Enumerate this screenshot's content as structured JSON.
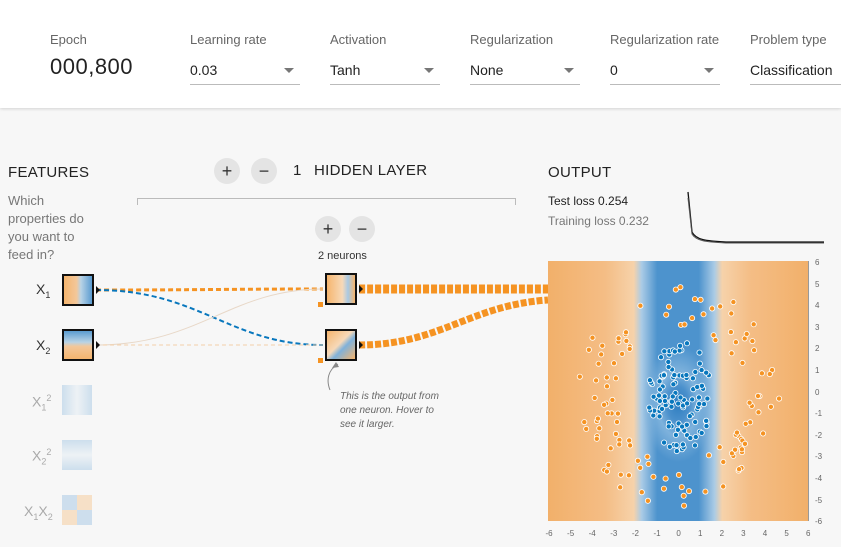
{
  "controls": {
    "epoch_label": "Epoch",
    "epoch_value": "000,800",
    "learning_rate_label": "Learning rate",
    "learning_rate_value": "0.03",
    "activation_label": "Activation",
    "activation_value": "Tanh",
    "regularization_label": "Regularization",
    "regularization_value": "None",
    "regularization_rate_label": "Regularization rate",
    "regularization_rate_value": "0",
    "problem_type_label": "Problem type",
    "problem_type_value": "Classification"
  },
  "features": {
    "title": "FEATURES",
    "question": "Which properties do you want to feed in?",
    "items": [
      {
        "base": "X",
        "sub": "1",
        "sup": "",
        "active": true
      },
      {
        "base": "X",
        "sub": "2",
        "sup": "",
        "active": true
      },
      {
        "base": "X",
        "sub": "1",
        "sup": "2",
        "active": false
      },
      {
        "base": "X",
        "sub": "2",
        "sup": "2",
        "active": false
      },
      {
        "base": "X",
        "sub": "1",
        "sup": "",
        "base2": "X",
        "sub2": "2",
        "active": false
      }
    ]
  },
  "network": {
    "plus": "+",
    "minus": "−",
    "layer_count": "1",
    "layers_label": "HIDDEN LAYER",
    "neurons_label": "2 neurons",
    "note": "This is the output from one neuron. Hover to see it larger."
  },
  "output": {
    "title": "OUTPUT",
    "test_loss": "Test loss 0.254",
    "training_loss": "Training loss 0.232",
    "y_ticks": [
      "6",
      "5",
      "4",
      "3",
      "2",
      "1",
      "0",
      "-1",
      "-2",
      "-3",
      "-4",
      "-5",
      "-6"
    ],
    "x_ticks": [
      "-6",
      "-5",
      "-4",
      "-3",
      "-2",
      "-1",
      "0",
      "1",
      "2",
      "3",
      "4",
      "5",
      "6"
    ]
  },
  "colors": {
    "orange": "#f59322",
    "blue": "#0877bd"
  }
}
